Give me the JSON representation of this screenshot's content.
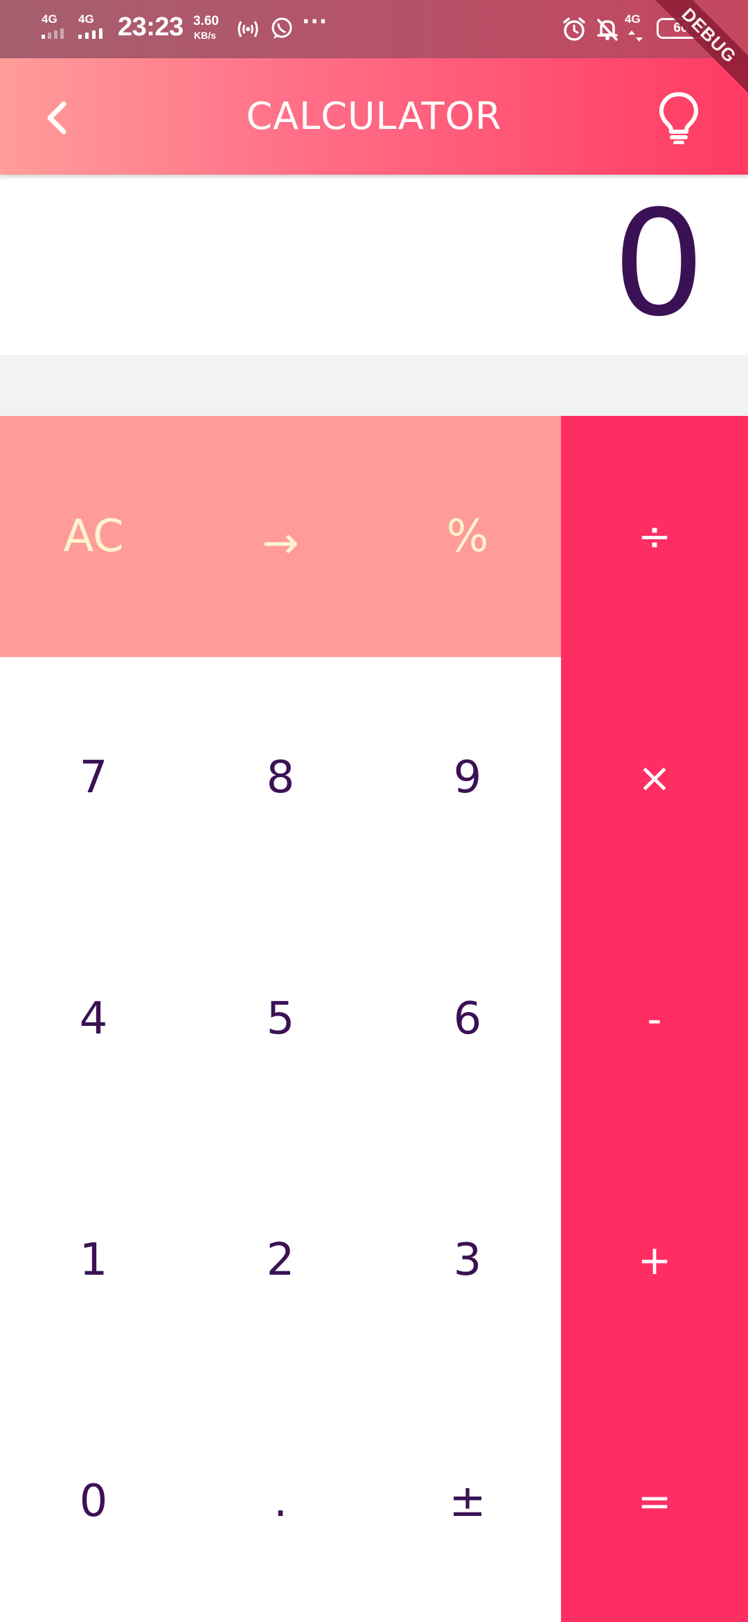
{
  "status_bar": {
    "network_1": "4G",
    "network_2": "4G",
    "time": "23:23",
    "speed_value": "3.60",
    "speed_unit": "KB/s",
    "more": "···",
    "network_3": "4G",
    "battery": "60",
    "icons": [
      "hotspot-icon",
      "whatsapp-icon",
      "alarm-icon",
      "notifications-off-icon"
    ]
  },
  "debug_banner": "DEBUG",
  "app_bar": {
    "title": "CALCULATOR",
    "back_icon": "chevron-left-icon",
    "theme_icon": "lightbulb-icon"
  },
  "display": {
    "value": "0"
  },
  "keypad": {
    "function_keys": [
      "AC",
      "→",
      "%"
    ],
    "operator_keys": [
      "÷",
      "×",
      "-",
      "+",
      "="
    ],
    "digit_rows": [
      [
        "7",
        "8",
        "9"
      ],
      [
        "4",
        "5",
        "6"
      ],
      [
        "1",
        "2",
        "3"
      ],
      [
        "0",
        ".",
        "±"
      ]
    ]
  },
  "colors": {
    "accent": "#ff2e62",
    "function_row": "#ff9c99",
    "digit_text": "#3b1155",
    "function_text": "#fff4cc",
    "display_band": "#f1f2f4"
  }
}
